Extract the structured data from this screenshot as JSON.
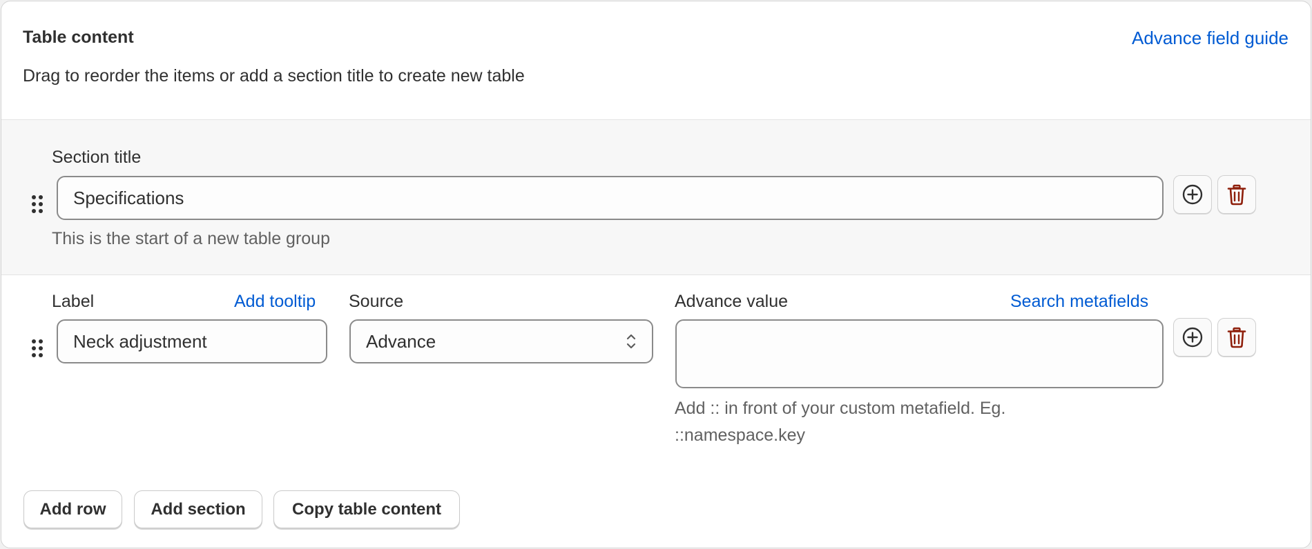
{
  "card": {
    "title": "Table content",
    "guide_link": "Advance field guide",
    "description": "Drag to reorder the items or add a section title to create new table"
  },
  "section_row": {
    "label": "Section title",
    "value": "Specifications",
    "help": "This is the start of a new table group"
  },
  "data_row": {
    "label_title": "Label",
    "tooltip_link": "Add tooltip",
    "label_value": "Neck adjustment",
    "source_title": "Source",
    "source_value": "Advance",
    "advance_title": "Advance value",
    "metafields_link": "Search metafields",
    "advance_value": "",
    "advance_help_line1": "Add :: in front of your custom metafield. Eg.",
    "advance_help_line2": "::namespace.key"
  },
  "buttons": {
    "add_row": "Add row",
    "add_section": "Add section",
    "copy_table": "Copy table content"
  },
  "colors": {
    "link": "#005bd3",
    "delete_icon": "#8e1f0b",
    "section_bg": "#f7f7f7"
  },
  "icons": {
    "drag": "drag-handle-icon",
    "add": "plus-circle-icon",
    "delete": "trash-icon",
    "select": "chevron-up-down-icon"
  }
}
